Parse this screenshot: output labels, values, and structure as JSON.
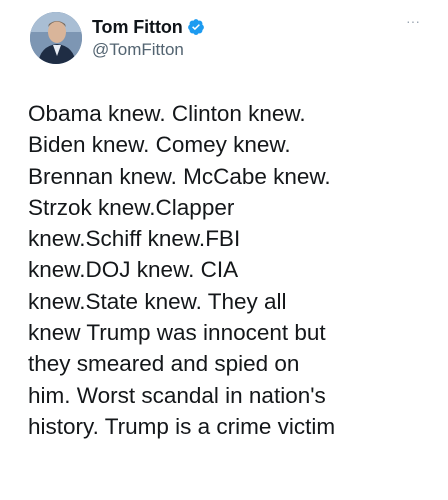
{
  "author": {
    "display_name": "Tom Fitton",
    "handle": "@TomFitton",
    "verified": true,
    "avatar_icon": "avatar-photo-icon",
    "verified_icon": "verified-badge-icon",
    "verified_color": "#1d9bf0"
  },
  "menu": {
    "more_icon": "more-options-icon",
    "more_glyph": "···"
  },
  "tweet": {
    "lines": [
      "Obama knew. Clinton knew.",
      "Biden knew. Comey knew.",
      "Brennan knew. McCabe knew.",
      "Strzok knew.Clapper",
      "knew.Schiff knew.FBI",
      "knew.DOJ knew. CIA",
      "knew.State knew. They all",
      "knew Trump was innocent but",
      "they smeared and spied on",
      "him. Worst scandal in nation's",
      "history. Trump is a crime victim"
    ]
  }
}
